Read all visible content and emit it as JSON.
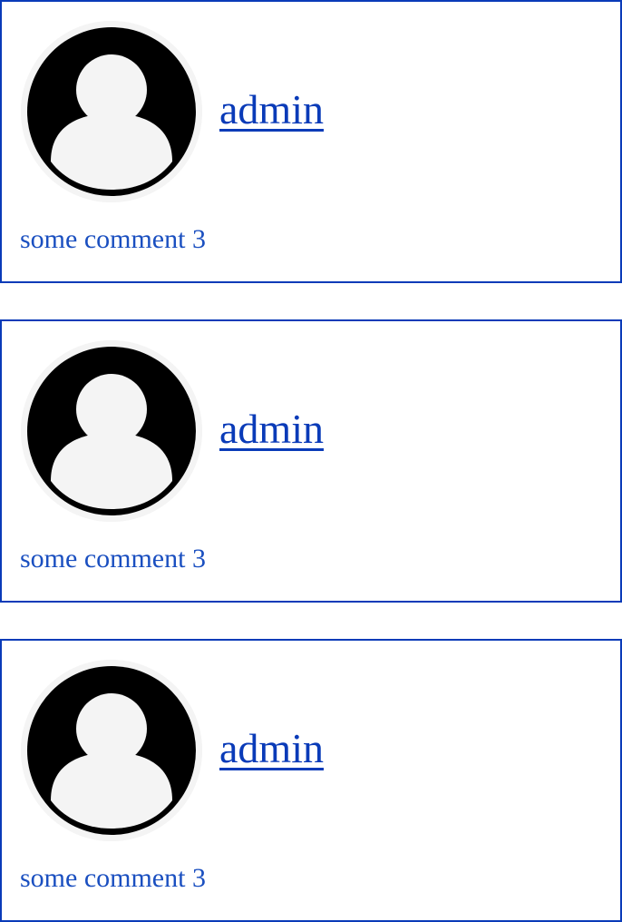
{
  "comments": [
    {
      "author": "admin",
      "text": "some comment 3",
      "avatar_icon": "default-user-avatar-icon"
    },
    {
      "author": "admin",
      "text": "some comment 3",
      "avatar_icon": "default-user-avatar-icon"
    },
    {
      "author": "admin",
      "text": "some comment 3",
      "avatar_icon": "default-user-avatar-icon"
    }
  ],
  "colors": {
    "border": "#0a3bb8",
    "link": "#0a3bb8",
    "comment_text": "#1a4fc0",
    "avatar_bg": "#f4f4f4",
    "avatar_fg": "#000000"
  }
}
